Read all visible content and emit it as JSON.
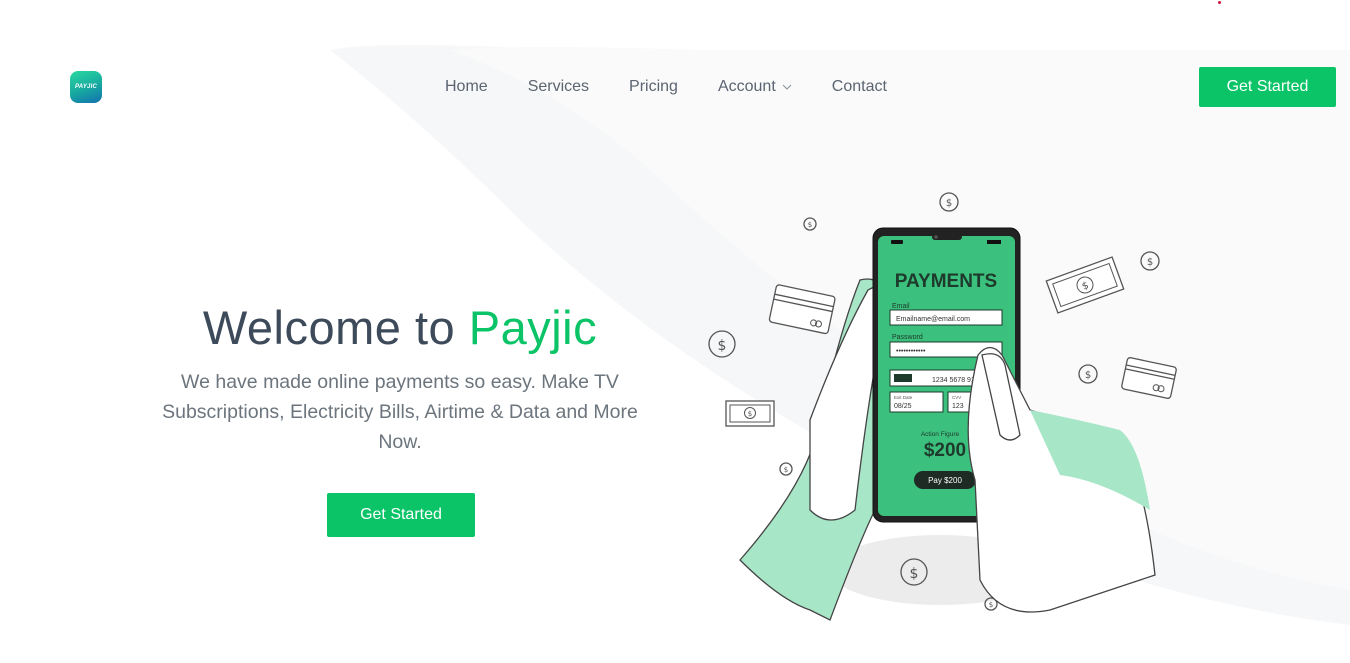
{
  "brand": {
    "logo_text": "PAYJIC",
    "accent_color": "#0ac467"
  },
  "nav": {
    "items": [
      {
        "label": "Home"
      },
      {
        "label": "Services"
      },
      {
        "label": "Pricing"
      },
      {
        "label": "Account",
        "has_dropdown": true
      },
      {
        "label": "Contact"
      }
    ],
    "cta_label": "Get Started"
  },
  "hero": {
    "title_prefix": "Welcome to",
    "title_brand": "Payjic",
    "subtitle": "We have made online payments so easy. Make TV Subscriptions, Electricity Bills, Airtime & Data and More Now.",
    "cta_label": "Get Started"
  },
  "phone": {
    "heading": "PAYMENTS",
    "email_label": "Email",
    "email_value": "Emailname@email.com",
    "password_label": "Password",
    "password_value": "••••••••••••",
    "card_number": "1234 5678 9101",
    "exp_label": "Exit Date",
    "exp_value": "08/25",
    "cvv_label": "CVV",
    "cvv_value": "123",
    "amount_label": "Action Figure",
    "amount_value": "$200",
    "pay_label": "Pay $200"
  }
}
